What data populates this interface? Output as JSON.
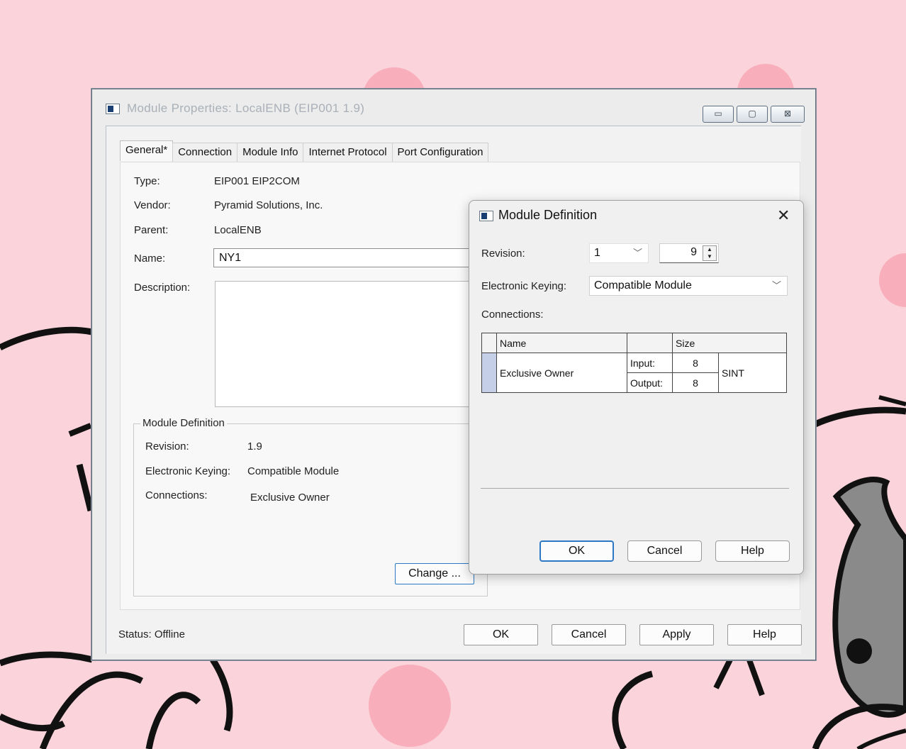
{
  "main_window": {
    "title": "Module Properties: LocalENB (EIP001 1.9)",
    "controls": {
      "minimize": "▭",
      "maximize": "▢",
      "close": "⊠"
    },
    "tabs": [
      "General*",
      "Connection",
      "Module Info",
      "Internet Protocol",
      "Port Configuration"
    ],
    "general": {
      "type_label": "Type:",
      "type_value": "EIP001 EIP2COM",
      "vendor_label": "Vendor:",
      "vendor_value": "Pyramid Solutions, Inc.",
      "parent_label": "Parent:",
      "parent_value": "LocalENB",
      "name_label": "Name:",
      "name_value": "NY1",
      "description_label": "Description:",
      "description_value": ""
    },
    "module_definition": {
      "title": "Module Definition",
      "revision_label": "Revision:",
      "revision_value": "1.9",
      "keying_label": "Electronic Keying:",
      "keying_value": "Compatible Module",
      "connections_label": "Connections:",
      "connections_value": "Exclusive Owner",
      "change_button": "Change ..."
    },
    "status_text": "Status:  Offline",
    "buttons": {
      "ok": "OK",
      "cancel": "Cancel",
      "apply": "Apply",
      "help": "Help"
    }
  },
  "dialog": {
    "title": "Module Definition",
    "close_glyph": "✕",
    "revision_label": "Revision:",
    "revision_major": "1",
    "revision_minor": "9",
    "keying_label": "Electronic Keying:",
    "keying_value": "Compatible Module",
    "connections_label": "Connections:",
    "table": {
      "headers": {
        "name": "Name",
        "size": "Size"
      },
      "row": {
        "name": "Exclusive Owner",
        "input_label": "Input:",
        "input_size": "8",
        "output_label": "Output:",
        "output_size": "8",
        "type": "SINT"
      }
    },
    "buttons": {
      "ok": "OK",
      "cancel": "Cancel",
      "help": "Help"
    }
  }
}
